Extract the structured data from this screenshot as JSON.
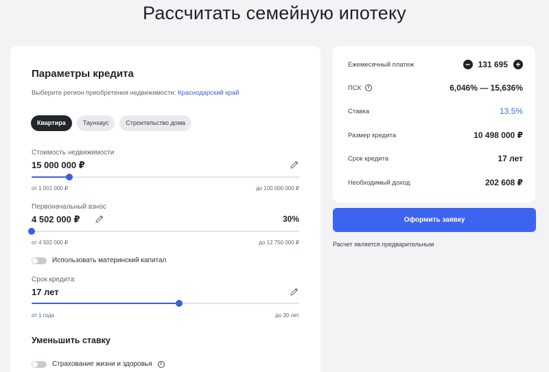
{
  "page": {
    "title": "Рассчитать семейную ипотеку"
  },
  "params": {
    "title": "Параметры кредита",
    "region_prompt": "Выберите регион приобретения недвижимости:",
    "region_value": "Краснодарский край",
    "types": [
      "Квартира",
      "Таунхаус",
      "Строительство дома"
    ],
    "active_type": "Квартира"
  },
  "price": {
    "label": "Стоимость недвижимости",
    "value": "15 000 000 ₽",
    "min_label": "от 1 001 000 ₽",
    "max_label": "до 100 000 000 ₽",
    "slider_fraction": 0.14
  },
  "down_payment": {
    "label": "Первоначальный взнос",
    "value": "4 502 000 ₽",
    "percent": "30%",
    "min_label": "от 4 502 000 ₽",
    "max_label": "до 12 750 000 ₽",
    "slider_fraction": 0.0
  },
  "maternity_capital": {
    "label": "Использовать материнский капитал",
    "enabled": false
  },
  "term": {
    "label": "Срок кредита",
    "value": "17 лет",
    "min_label": "от 1 года",
    "max_label": "до 30 лет",
    "slider_fraction": 0.552
  },
  "reduce_rate": {
    "title": "Уменьшить ставку",
    "insurance_label": "Страхование жизни и здоровья",
    "insurance_enabled": false
  },
  "summary": {
    "monthly_label": "Ежемесячный платеж",
    "monthly_value": "131 695",
    "psk_label": "ПСК",
    "psk_value": "6,046% — 15,636%",
    "rate_label": "Ставка",
    "rate_value": "13.5%",
    "loan_label": "Размер кредита",
    "loan_value": "10 498 000 ₽",
    "term_label": "Срок кредита",
    "term_value": "17 лет",
    "income_label": "Необходимый доход",
    "income_value": "202 608 ₽"
  },
  "actions": {
    "submit_label": "Оформить заявку",
    "disclaimer": "Расчет является предварительным"
  },
  "colors": {
    "accent": "#3d64f0",
    "background": "#f2f3f5",
    "chip_active": "#22252b"
  },
  "icons": {
    "edit": "pencil-icon",
    "info": "info-icon",
    "minus": "minus-icon",
    "plus": "plus-icon"
  }
}
